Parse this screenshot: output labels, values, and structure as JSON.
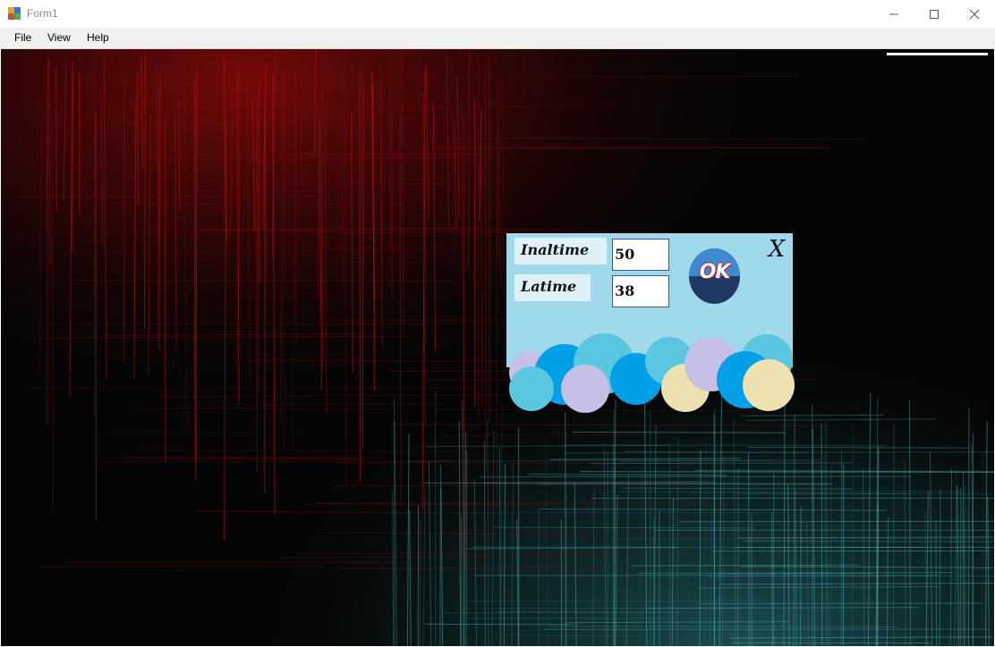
{
  "window": {
    "title": "Form1",
    "minimize_icon": "minimize-icon",
    "maximize_icon": "maximize-icon",
    "close_icon": "close-icon"
  },
  "menu": {
    "items": [
      {
        "label": "File"
      },
      {
        "label": "View"
      },
      {
        "label": "Help"
      }
    ]
  },
  "dialog": {
    "label_inaltime": "Inaltime",
    "value_inaltime": "50",
    "label_latime": "Latime",
    "value_latime": "38",
    "ok_label": "OK",
    "close_label": "X",
    "panel_color": "#9fd9ea"
  },
  "colors": {
    "background": "#050505",
    "red_texture": "#8b0a0a",
    "teal_texture": "#3a8c8c",
    "bubble_blue": "#00a0e6",
    "bubble_light_blue": "#5bc6e0",
    "bubble_lavender": "#c8bfe6",
    "bubble_cream": "#ede1b0"
  }
}
